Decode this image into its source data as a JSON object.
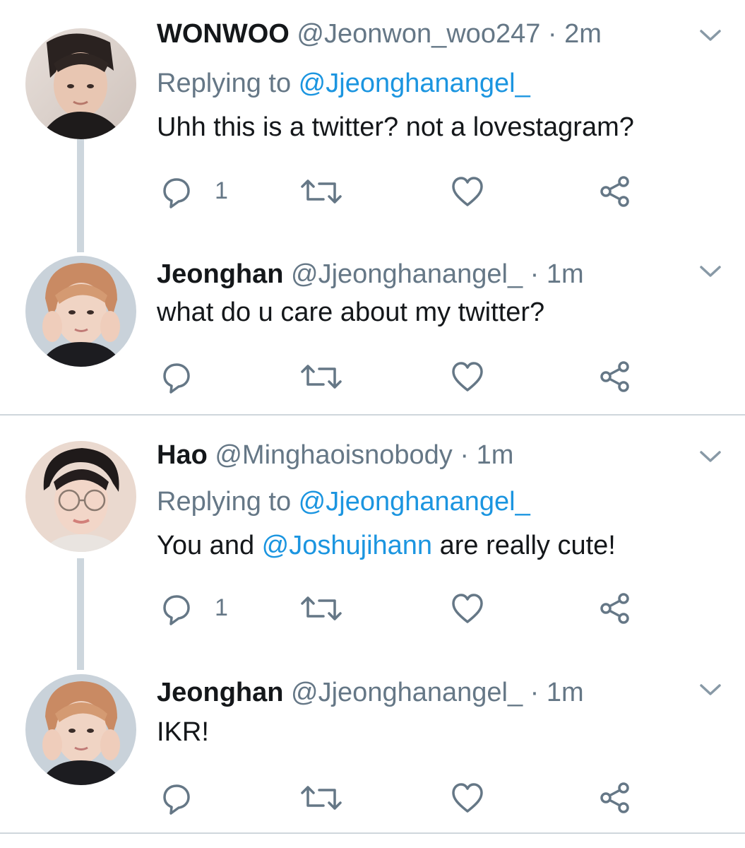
{
  "colors": {
    "accent": "#1b95e0",
    "secondary_text": "#657786",
    "primary_text": "#14171a",
    "thread_line": "#cdd6dd",
    "divider": "#cfd6dc"
  },
  "icons": {
    "reply": "speech-bubble-icon",
    "retweet": "retweet-icon",
    "like": "heart-icon",
    "share": "share-icon",
    "more": "chevron-down-icon"
  },
  "threads": [
    {
      "tweets": [
        {
          "name": "WONWOO",
          "handle": "@Jeonwon_woo247",
          "separator": " · ",
          "time": "2m",
          "replying_prefix": "Replying to ",
          "replying_handle": "@Jjeonghanangel_",
          "text": "Uhh this is a twitter? not a lovestagram?",
          "reply_count": "1"
        },
        {
          "name": "Jeonghan",
          "handle": "@Jjeonghanangel_",
          "separator": " · ",
          "time": "1m",
          "text": "what do u care about my twitter?"
        }
      ]
    },
    {
      "tweets": [
        {
          "name": "Hao",
          "handle": "@Minghaoisnobody",
          "separator": " · ",
          "time": "1m",
          "replying_prefix": "Replying to ",
          "replying_handle": "@Jjeonghanangel_",
          "text_before": "You and ",
          "text_mention": "@Joshujihann",
          "text_after": " are really cute!",
          "reply_count": "1"
        },
        {
          "name": "Jeonghan",
          "handle": "@Jjeonghanangel_",
          "separator": " · ",
          "time": "1m",
          "text": "IKR!"
        }
      ]
    }
  ]
}
